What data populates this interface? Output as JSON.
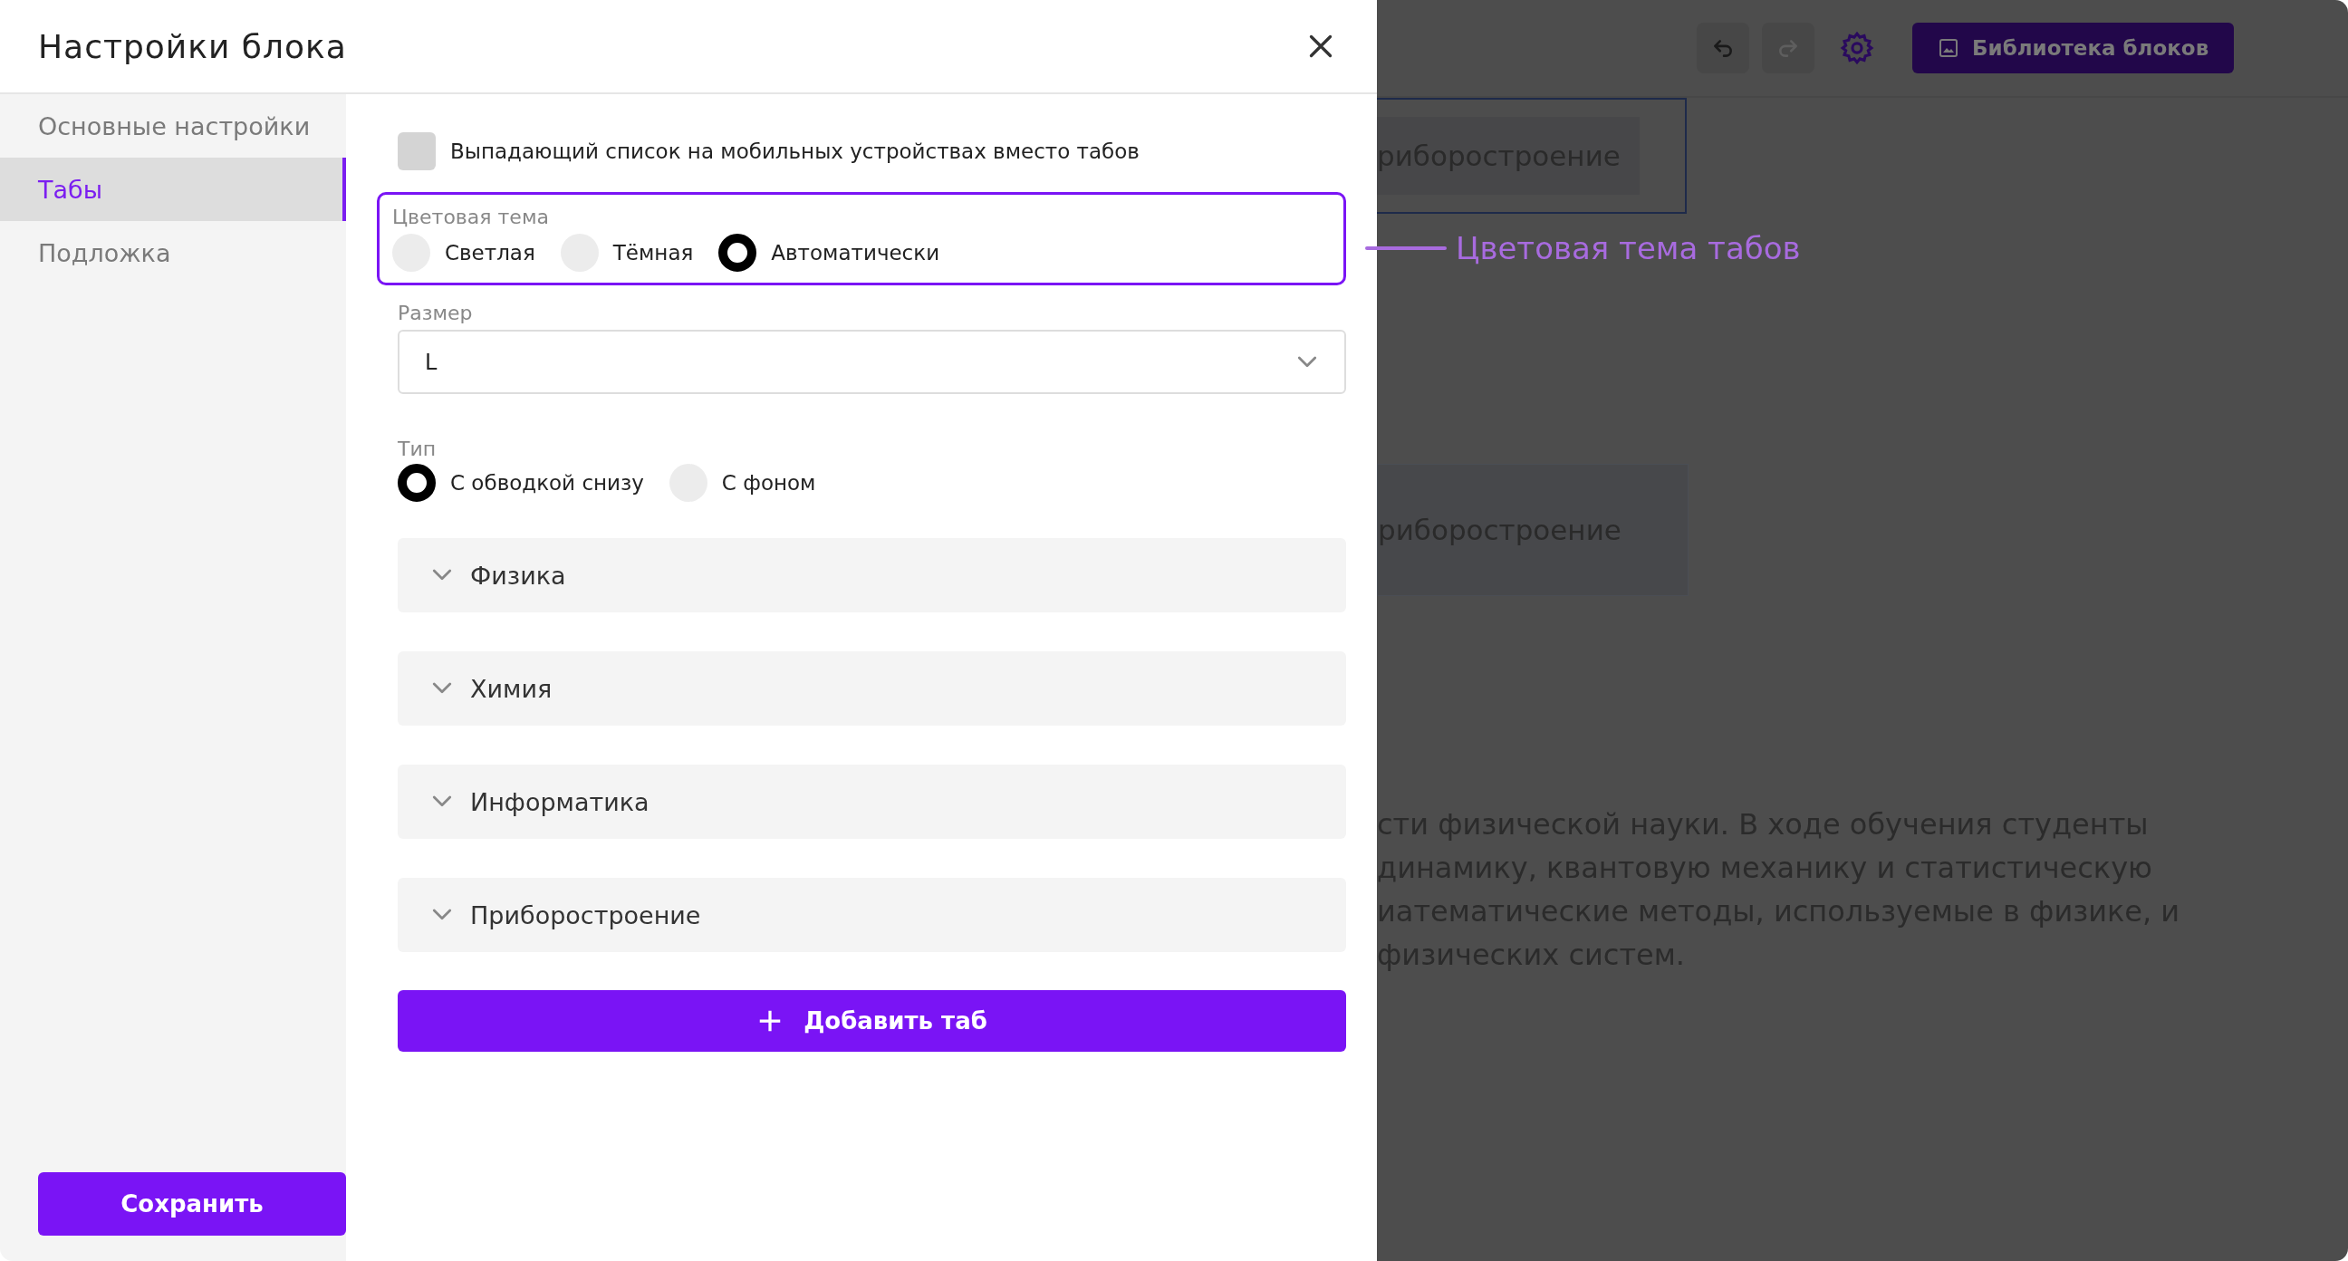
{
  "dialog": {
    "title": "Настройки блока",
    "sidebar": {
      "items": [
        {
          "label": "Основные настройки",
          "selected": false
        },
        {
          "label": "Табы",
          "selected": true
        },
        {
          "label": "Подложка",
          "selected": false
        }
      ],
      "save_button": "Сохранить"
    },
    "settings": {
      "mobile_dropdown": {
        "label": "Выпадающий список на мобильных устройствах вместо табов",
        "checked": false
      },
      "color_theme": {
        "label": "Цветовая тема",
        "options": [
          {
            "label": "Светлая",
            "selected": false
          },
          {
            "label": "Тёмная",
            "selected": false
          },
          {
            "label": "Автоматически",
            "selected": true
          }
        ]
      },
      "size": {
        "label": "Размер",
        "value": "L"
      },
      "type": {
        "label": "Тип",
        "options": [
          {
            "label": "С обводкой снизу",
            "selected": true
          },
          {
            "label": "С фоном",
            "selected": false
          }
        ]
      },
      "tabs": [
        {
          "label": "Физика",
          "expanded": false
        },
        {
          "label": "Химия",
          "expanded": false
        },
        {
          "label": "Информатика",
          "expanded": false
        },
        {
          "label": "Приборостроение",
          "expanded": false
        }
      ],
      "add_button": "Добавить таб"
    }
  },
  "annotation": "Цветовая тема табов",
  "background": {
    "toolbar": {
      "undo": {
        "disabled": false
      },
      "redo": {
        "disabled": true
      },
      "library_button": "Библиотека блоков"
    },
    "tab_previews": [
      "риборостроение",
      "риборостроение"
    ],
    "paragraph_lines": [
      "сти физической науки. В ходе обучения студенты",
      "динамику, квантовую механику и статистическую",
      "иатематические методы, используемые в физике, и",
      "физических систем."
    ]
  }
}
